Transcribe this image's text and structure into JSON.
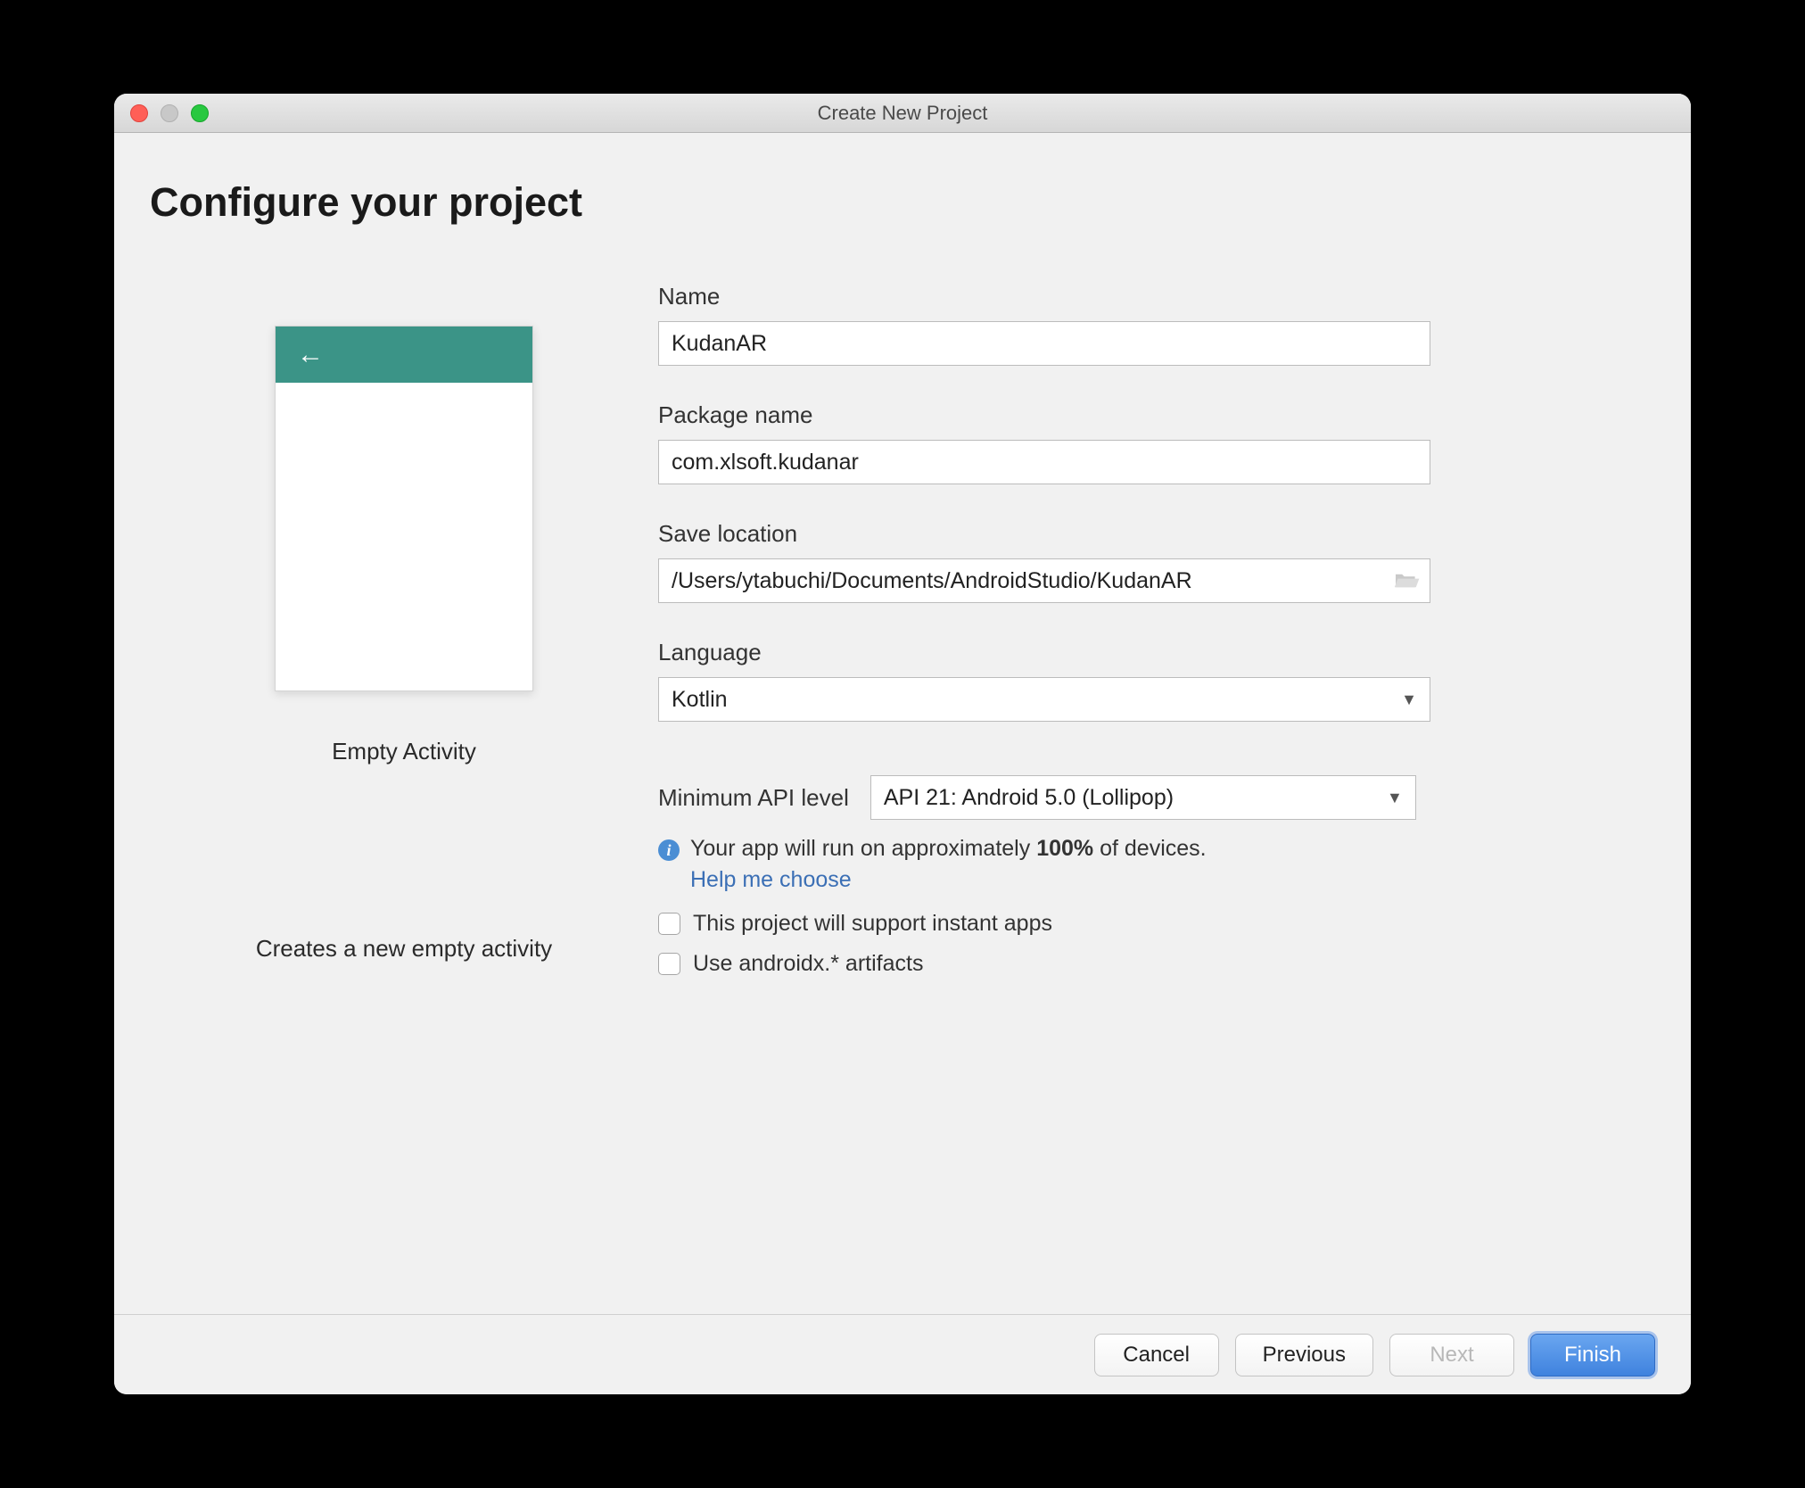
{
  "window": {
    "title": "Create New Project"
  },
  "page": {
    "heading": "Configure your project"
  },
  "preview": {
    "template_name": "Empty Activity",
    "template_desc": "Creates a new empty activity"
  },
  "fields": {
    "name": {
      "label": "Name",
      "value": "KudanAR"
    },
    "package": {
      "label": "Package name",
      "value": "com.xlsoft.kudanar"
    },
    "location": {
      "label": "Save location",
      "value": "/Users/ytabuchi/Documents/AndroidStudio/KudanAR"
    },
    "language": {
      "label": "Language",
      "value": "Kotlin"
    },
    "api": {
      "label": "Minimum API level",
      "value": "API 21: Android 5.0 (Lollipop)"
    }
  },
  "info": {
    "text_1": "Your app will run on approximately ",
    "percent": "100%",
    "text_2": " of devices.",
    "help": "Help me choose"
  },
  "checkboxes": {
    "instant": "This project will support instant apps",
    "androidx": "Use androidx.* artifacts"
  },
  "buttons": {
    "cancel": "Cancel",
    "previous": "Previous",
    "next": "Next",
    "finish": "Finish"
  }
}
